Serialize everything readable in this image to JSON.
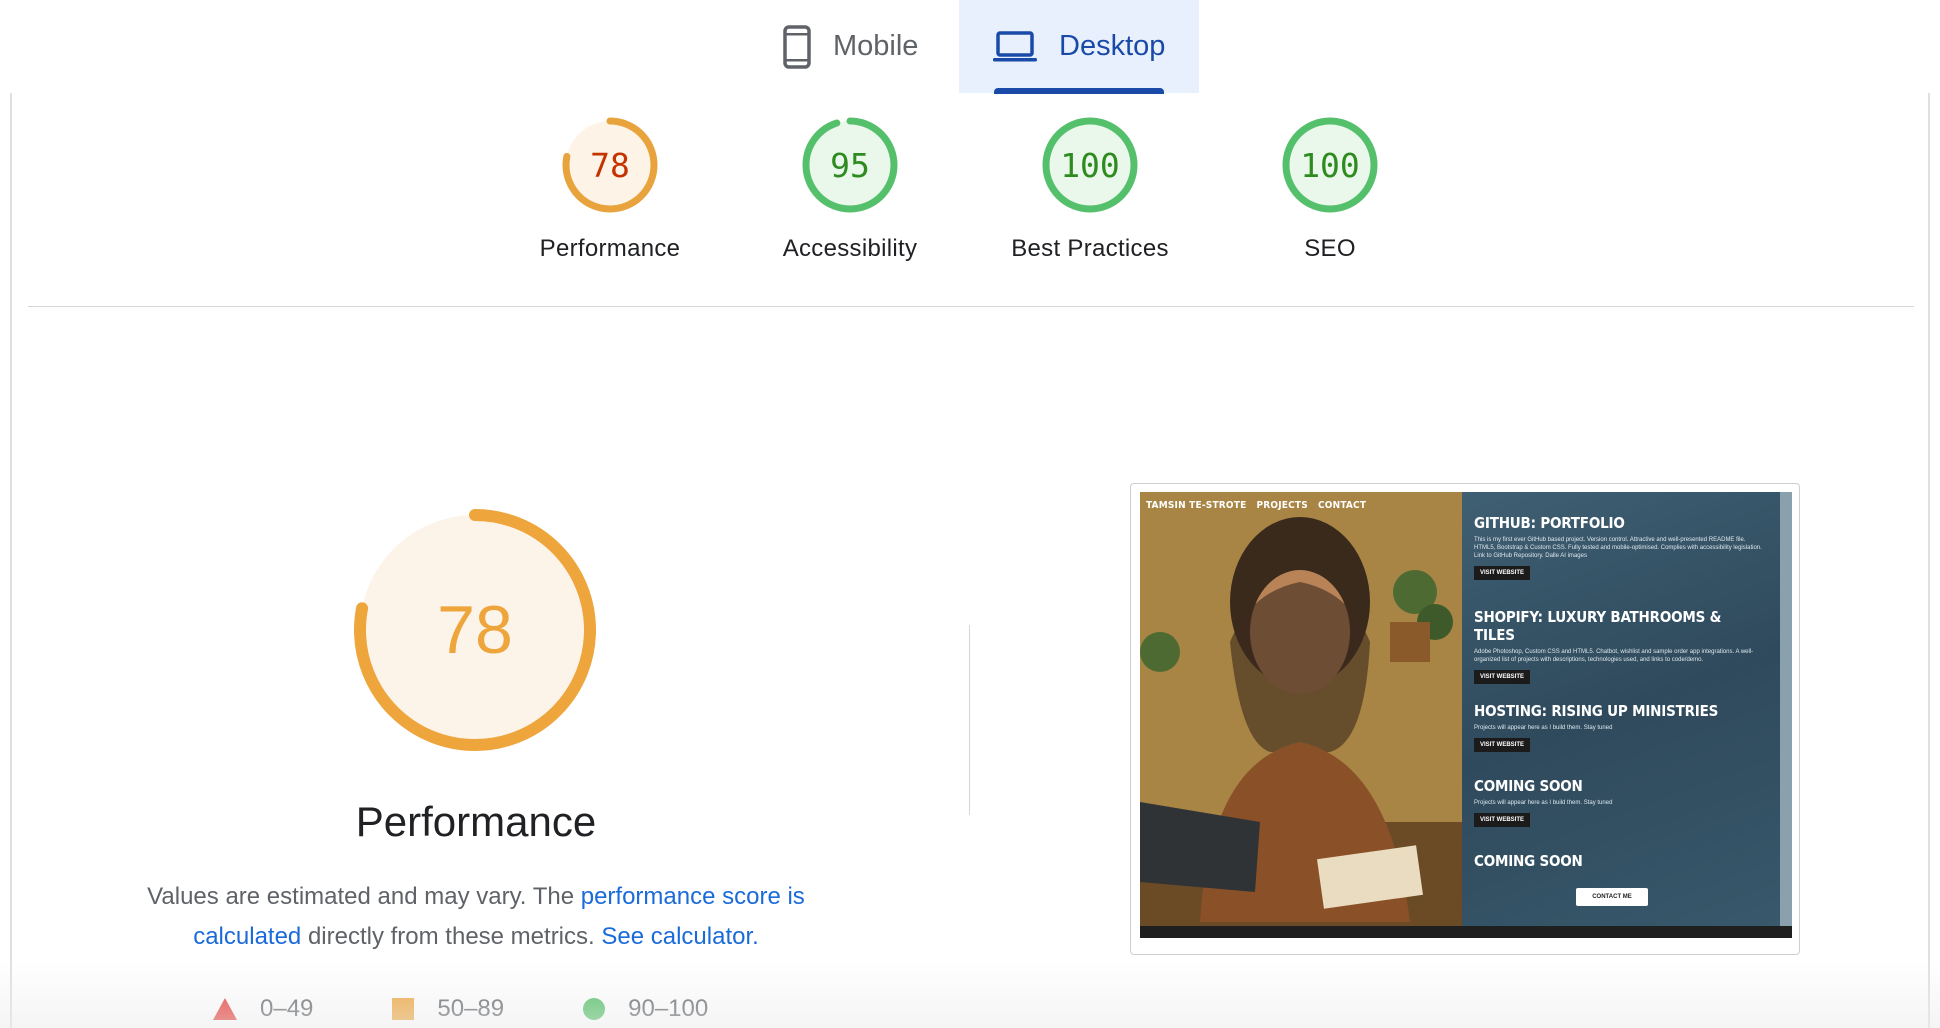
{
  "tabs": {
    "mobile_label": "Mobile",
    "desktop_label": "Desktop",
    "selected": "Desktop"
  },
  "categories": [
    {
      "label": "Performance",
      "score": "78",
      "value": 78,
      "color": "#e8a33c",
      "text_color": "#c33300"
    },
    {
      "label": "Accessibility",
      "score": "95",
      "value": 95,
      "color": "#55c06b",
      "text_color": "#2e8b1f"
    },
    {
      "label": "Best Practices",
      "score": "100",
      "value": 100,
      "color": "#55c06b",
      "text_color": "#2e8b1f"
    },
    {
      "label": "SEO",
      "score": "100",
      "value": 100,
      "color": "#55c06b",
      "text_color": "#2e8b1f"
    }
  ],
  "performance_detail": {
    "score": "78",
    "value": 78,
    "color": "#eea53c",
    "title": "Performance",
    "desc_prefix": "Values are estimated and may vary. The ",
    "desc_link1": "performance score is calculated",
    "desc_middle": " directly from these metrics. ",
    "desc_link2": "See calculator."
  },
  "legend": [
    {
      "range": "0–49",
      "shape": "triangle",
      "color": "#e53935"
    },
    {
      "range": "50–89",
      "shape": "square",
      "color": "#eea53c"
    },
    {
      "range": "90–100",
      "shape": "circle",
      "color": "#4fbf63"
    }
  ],
  "screenshot": {
    "nav": [
      "TAMSIN TE-STROTE",
      "PROJECTS",
      "CONTACT"
    ],
    "projects": [
      {
        "title": "GITHUB: PORTFOLIO",
        "text": "This is my first ever GitHub based project. Version control. Attractive and well-presented README file. HTML5, Bootstrap & Custom CSS. Fully tested and mobile-optimised. Complies with accessibility legislation. Link to GitHub Repository. Dalle AI images",
        "button": "VISIT WEBSITE"
      },
      {
        "title": "SHOPIFY: LUXURY BATHROOMS & TILES",
        "text": "Adobe Photoshop, Custom CSS and HTML5. Chatbot, wishlist and sample order app integrations. A well-organized list of projects with descriptions, technologies used, and links to code/demo.",
        "button": "VISIT WEBSITE"
      },
      {
        "title": "HOSTING: RISING UP MINISTRIES",
        "text": "Projects will appear here as I build them. Stay tuned",
        "button": "VISIT WEBSITE"
      },
      {
        "title": "COMING SOON",
        "text": "Projects will appear here as I build them. Stay tuned",
        "button": "VISIT WEBSITE"
      },
      {
        "title": "COMING SOON",
        "text": "",
        "button": ""
      }
    ],
    "contact_button": "CONTACT ME"
  }
}
